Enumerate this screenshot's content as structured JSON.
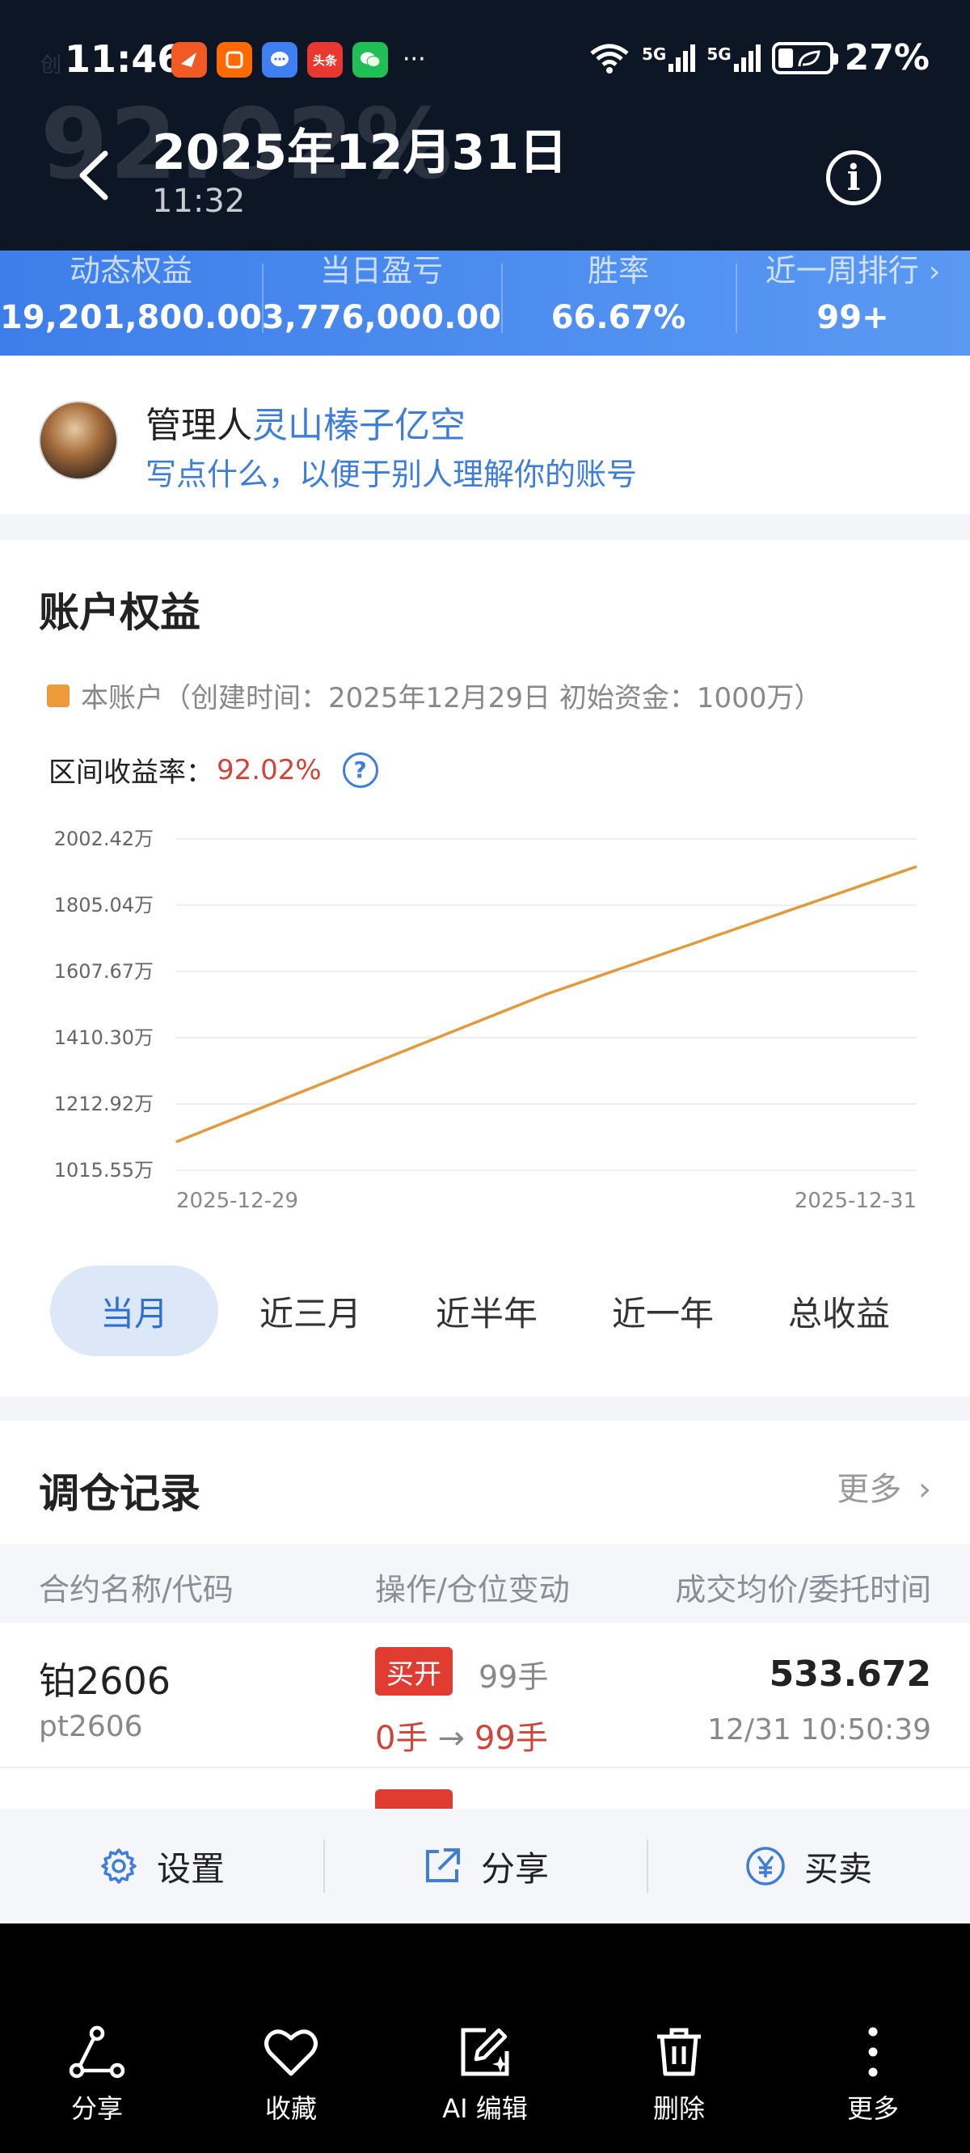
{
  "status_bar": {
    "time": "11:46",
    "app_icons": [
      {
        "name": "feishu-icon",
        "color": "#f15a24",
        "text": ""
      },
      {
        "name": "app-orange-icon",
        "color": "#ff6a00",
        "text": ""
      },
      {
        "name": "message-icon",
        "color": "#3f7ff2",
        "text": ""
      },
      {
        "name": "toutiao-icon",
        "color": "#e8382f",
        "text": "头条"
      },
      {
        "name": "wechat-icon",
        "color": "#1fbf55",
        "text": ""
      }
    ],
    "more_dots": "···",
    "signal_1": "5G",
    "signal_2": "5G",
    "battery": "27%"
  },
  "header": {
    "ghost_title": "92.02%",
    "title": "2025年12月31日",
    "time": "11:32"
  },
  "stats": [
    {
      "label": "动态权益",
      "value": "19,201,800.00"
    },
    {
      "label": "当日盈亏",
      "value": "3,776,000.00"
    },
    {
      "label": "胜率",
      "value": "66.67%"
    },
    {
      "label": "近一周排行",
      "value": "99+"
    }
  ],
  "manager": {
    "prefix": "管理人",
    "name": "灵山榛子亿空",
    "desc": "写点什么，以便于别人理解你的账号"
  },
  "equity": {
    "title": "账户权益",
    "legend": "本账户（创建时间：2025年12月29日 初始资金：1000万）",
    "range_label": "区间收益率：",
    "range_value": "92.02%",
    "help_icon_text": "?"
  },
  "chart_data": {
    "type": "line",
    "y_ticks": [
      "2002.42万",
      "1805.04万",
      "1607.67万",
      "1410.30万",
      "1212.92万",
      "1015.55万"
    ],
    "x_tick_labels": [
      "2025-12-29",
      "2025-12-31"
    ],
    "ylim": [
      1015.55,
      2002.42
    ],
    "series": [
      {
        "color": "#e39a3a",
        "points": [
          {
            "x": "2025-12-29",
            "y": 1100
          },
          {
            "x": "2025-12-30",
            "y": 1540
          },
          {
            "x": "2025-12-31",
            "y": 1920
          }
        ]
      }
    ],
    "grid": true
  },
  "tabs": [
    {
      "label": "当月",
      "active": true
    },
    {
      "label": "近三月",
      "active": false
    },
    {
      "label": "近半年",
      "active": false
    },
    {
      "label": "近一年",
      "active": false
    },
    {
      "label": "总收益",
      "active": false
    }
  ],
  "records": {
    "title": "调仓记录",
    "more": "更多",
    "columns": [
      "合约名称/代码",
      "操作/仓位变动",
      "成交均价/委托时间"
    ],
    "rows": [
      {
        "name": "铂2606",
        "code": "pt2606",
        "op": "买开",
        "qty": "99手",
        "pos_from": "0手",
        "pos_to": "99手",
        "price": "533.672",
        "time": "12/31 10:50:39"
      }
    ]
  },
  "action_bar": {
    "settings": "设置",
    "share": "分享",
    "trade": "买卖"
  },
  "bottom_bar": [
    {
      "label": "分享"
    },
    {
      "label": "收藏"
    },
    {
      "label": "AI 编辑"
    },
    {
      "label": "删除"
    },
    {
      "label": "更多"
    }
  ]
}
